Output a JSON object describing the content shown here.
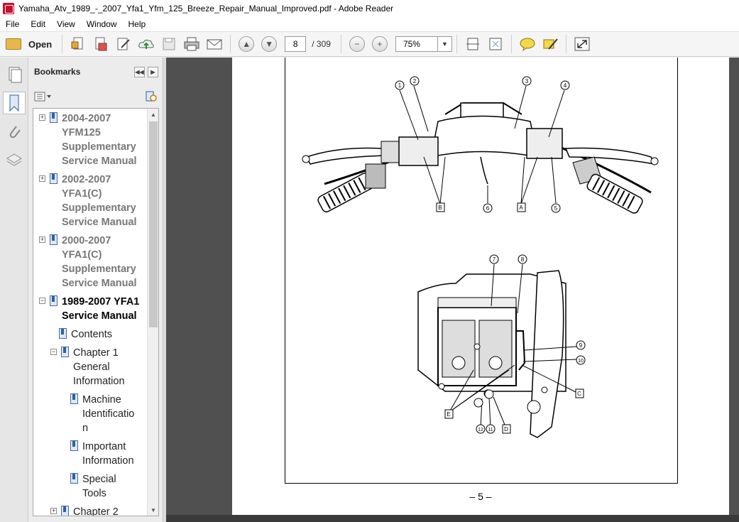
{
  "window": {
    "title": "Yamaha_Atv_1989_-_2007_Yfa1_Yfm_125_Breeze_Repair_Manual_Improved.pdf - Adobe Reader"
  },
  "menu": [
    "File",
    "Edit",
    "View",
    "Window",
    "Help"
  ],
  "toolbar": {
    "open_label": "Open",
    "page_current": "8",
    "page_total": "/ 309",
    "zoom": "75%"
  },
  "bookmarks": {
    "title": "Bookmarks",
    "items": [
      {
        "label": "2004-2007 YFM125 Supplementary Service Manual",
        "lines": [
          "2004-2007",
          "YFM125",
          "Supplementary",
          "Service Manual"
        ]
      },
      {
        "label": "2002-2007 YFA1(C) Supplementary Service Manual",
        "lines": [
          "2002-2007",
          "YFA1(C)",
          "Supplementary",
          "Service Manual"
        ]
      },
      {
        "label": "2000-2007 YFA1(C) Supplementary Service Manual",
        "lines": [
          "2000-2007",
          "YFA1(C)",
          "Supplementary",
          "Service Manual"
        ]
      },
      {
        "label": "1989-2007 YFA1 Service Manual",
        "lines": [
          "1989-2007 YFA1",
          "Service Manual"
        ]
      },
      {
        "label": "Contents",
        "lines": [
          "Contents"
        ]
      },
      {
        "label": "Chapter 1 General Information",
        "lines": [
          "Chapter 1",
          "General",
          "Information"
        ]
      },
      {
        "label": "Machine Identification",
        "lines": [
          "Machine",
          "Identificatio",
          "n"
        ]
      },
      {
        "label": "Important Information",
        "lines": [
          "Important",
          "Information"
        ]
      },
      {
        "label": "Special Tools",
        "lines": [
          "Special",
          "Tools"
        ]
      },
      {
        "label": "Chapter 2",
        "lines": [
          "Chapter 2"
        ]
      }
    ]
  },
  "document": {
    "page_number": "– 5 –",
    "callouts_top": [
      "1",
      "2",
      "3",
      "4",
      "5",
      "6",
      "A",
      "B"
    ],
    "callouts_bottom": [
      "7",
      "8",
      "9",
      "10",
      "11",
      "12",
      "C",
      "D",
      "E"
    ]
  }
}
